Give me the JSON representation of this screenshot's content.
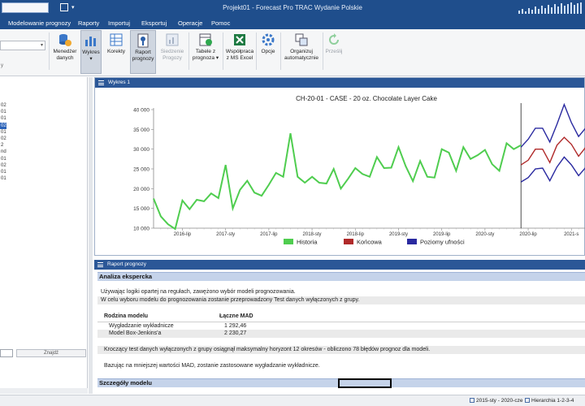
{
  "titlebar": {
    "title": "Projekt01 - Forecast Pro TRAC Wydanie Polskie",
    "accent": "#1f4e8c"
  },
  "menu": [
    {
      "label": "Modelowanie prognozy"
    },
    {
      "label": "Raporty"
    },
    {
      "label": "Importuj"
    },
    {
      "label": "Eksportuj"
    },
    {
      "label": "Operacje"
    },
    {
      "label": "Pomoc"
    }
  ],
  "ribbon": [
    {
      "label": "Menedżer\ndanych",
      "icon": "data-manager-icon"
    },
    {
      "label": "Wykres\n▾",
      "icon": "chart-icon"
    },
    {
      "label": "Korekty",
      "icon": "adjustments-icon"
    },
    {
      "label": "Raport\nprognozy",
      "icon": "forecast-report-icon"
    },
    {
      "label": "Siedzenie\nProgozy",
      "icon": "tracking-icon"
    },
    {
      "label": "Tabele z\nprognoza ▾",
      "icon": "tables-icon"
    },
    {
      "label": "Współpraca\nz MS Excel",
      "icon": "excel-icon"
    },
    {
      "label": "Opcje",
      "icon": "options-icon"
    },
    {
      "label": "Organizuj\nautomatycznie",
      "icon": "organize-icon"
    },
    {
      "label": "Prześlij",
      "icon": "refresh-icon"
    }
  ],
  "left": {
    "tree": [
      "02",
      "01",
      "01",
      "02",
      "01",
      "02",
      "2",
      "nd",
      "01",
      "02",
      "01",
      "01"
    ],
    "selected_index": 3,
    "find_label": "Znajdź"
  },
  "chart_window": {
    "title": "Wykres 1"
  },
  "chart_data": {
    "type": "line",
    "title": "CH-20-01 - CASE - 20 oz. Chocolate Layer Cake",
    "ylim": [
      10000,
      40000
    ],
    "yticks": [
      "10 000",
      "15 000",
      "20 000",
      "25 000",
      "30 000",
      "35 000",
      "40 000"
    ],
    "xticks": [
      {
        "label": "2016-lip",
        "x": 4
      },
      {
        "label": "2017-sty",
        "x": 10
      },
      {
        "label": "2017-lip",
        "x": 16
      },
      {
        "label": "2018-sty",
        "x": 22
      },
      {
        "label": "2018-lip",
        "x": 28
      },
      {
        "label": "2019-sty",
        "x": 34
      },
      {
        "label": "2019-lip",
        "x": 40
      },
      {
        "label": "2020-sty",
        "x": 46
      },
      {
        "label": "2020-lip",
        "x": 52
      },
      {
        "label": "2021-s",
        "x": 58
      }
    ],
    "x_span": [
      0,
      60
    ],
    "forecast_start": 51,
    "series": [
      {
        "name": "Historia",
        "color": "#4fcd4f",
        "x": [
          0,
          1,
          2,
          3,
          4,
          5,
          6,
          7,
          8,
          9,
          10,
          11,
          12,
          13,
          14,
          15,
          16,
          17,
          18,
          19,
          20,
          21,
          22,
          23,
          24,
          25,
          26,
          27,
          28,
          29,
          30,
          31,
          32,
          33,
          34,
          35,
          36,
          37,
          38,
          39,
          40,
          41,
          42,
          43,
          44,
          45,
          46,
          47,
          48,
          49,
          50,
          51
        ],
        "values": [
          17500,
          13000,
          11000,
          9800,
          17000,
          14800,
          17200,
          16800,
          18800,
          17600,
          26000,
          15000,
          19700,
          22000,
          19000,
          18200,
          21000,
          24000,
          23000,
          34000,
          23000,
          21500,
          23000,
          21500,
          21300,
          25000,
          20000,
          22500,
          25200,
          23700,
          23000,
          28000,
          25200,
          25300,
          30500,
          25700,
          21900,
          27000,
          23000,
          22800,
          30000,
          29100,
          24500,
          30500,
          27500,
          28500,
          29800,
          26200,
          24500,
          31500,
          30000,
          31000
        ]
      },
      {
        "name": "Końcowa",
        "color": "#b02a2a",
        "x": [
          51,
          52,
          53,
          54,
          55,
          56,
          57,
          58,
          59,
          60
        ],
        "values": [
          26000,
          27200,
          30000,
          30000,
          26600,
          31000,
          33000,
          31200,
          28200,
          30500
        ]
      },
      {
        "name": "Poziomy ufności",
        "color": "#2a2aa0",
        "x": [
          51,
          52,
          53,
          54,
          55,
          56,
          57,
          58,
          59,
          60
        ],
        "values": [
          30500,
          32500,
          35300,
          35300,
          31800,
          36300,
          41300,
          36700,
          33200,
          35400
        ]
      },
      {
        "name": "Poziomy ufności dolny",
        "color": "#2a2aa0",
        "x": [
          51,
          52,
          53,
          54,
          55,
          56,
          57,
          58,
          59,
          60
        ],
        "values": [
          21700,
          22800,
          25000,
          25200,
          22000,
          25500,
          28000,
          26000,
          23300,
          25400
        ]
      }
    ],
    "legend": [
      {
        "label": "Historia",
        "color": "#4fcd4f"
      },
      {
        "label": "Końcowa",
        "color": "#b02a2a"
      },
      {
        "label": "Poziomy ufności",
        "color": "#2a2aa0"
      }
    ]
  },
  "report": {
    "window_title": "Raport prognozy",
    "section1": "Analiza ekspercka",
    "line1": "Używając logiki opartej na regułach, zawężono wybór modeli prognozowania.",
    "line2": "W celu wyboru modelu do prognozowania zostanie przeprowadzony Test danych wyłączonych z grupy.",
    "col_family": "Rodzina modelu",
    "col_mad": "Łączne MAD",
    "rows": [
      {
        "family": "Wygładzanie wykładnicze",
        "mad": "1 292,46"
      },
      {
        "family": "Model Box-Jenkins'a",
        "mad": "2 230,27"
      }
    ],
    "line3": "Kroczący test danych wyłączonych z grupy osiągnął maksymalny horyzont 12 okresów - obliczono 78 błędów prognoz dla modeli.",
    "line4": "Bazując na mniejszej wartości MAD, zostanie zastosowane wygładzanie wykładnicze.",
    "section2": "Szczegóły modelu"
  },
  "status": {
    "period": "2015-sty - 2020-cze",
    "hierarchy": "Hierarchia 1-2-3-4"
  }
}
